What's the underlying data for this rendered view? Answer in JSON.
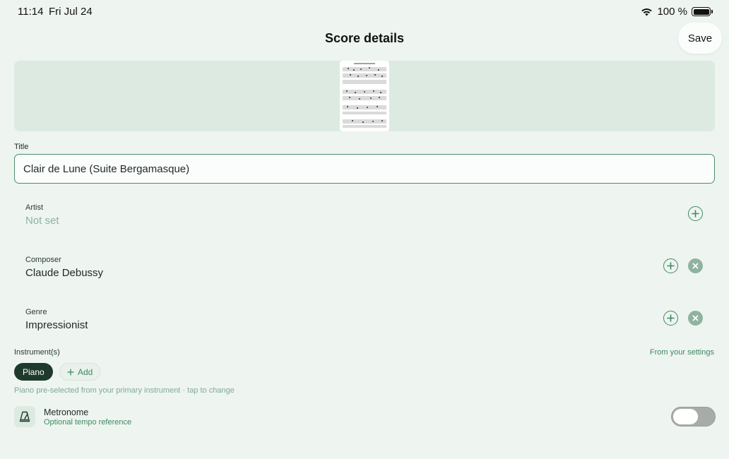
{
  "status_bar": {
    "time": "11:14",
    "date": "Fri Jul 24",
    "battery": "100 %",
    "wifi_icon": "wifi-icon",
    "battery_icon": "battery-icon"
  },
  "header": {
    "title": "Score details",
    "save_label": "Save"
  },
  "cover": {
    "icon": "sheet-music-thumbnail"
  },
  "title_field": {
    "label": "Title",
    "value": "Clair de Lune (Suite Bergamasque)"
  },
  "fields": {
    "artist": {
      "label": "Artist",
      "value": "Not set"
    },
    "composer": {
      "label": "Composer",
      "value": "Claude Debussy"
    },
    "genre": {
      "label": "Genre",
      "value": "Impressionist"
    }
  },
  "instruments": {
    "label": "Instrument(s)",
    "source": "From your settings",
    "selected": "Piano",
    "add_label": "Add",
    "hint": "Piano pre-selected from your primary instrument · tap to change"
  },
  "metronome": {
    "title": "Metronome",
    "subtitle": "Optional tempo reference",
    "enabled": false
  },
  "colors": {
    "background": "#eef4f0",
    "accent": "#3d8a61",
    "chip_dark": "#1e3a2c",
    "muted": "#8fb3a0"
  }
}
